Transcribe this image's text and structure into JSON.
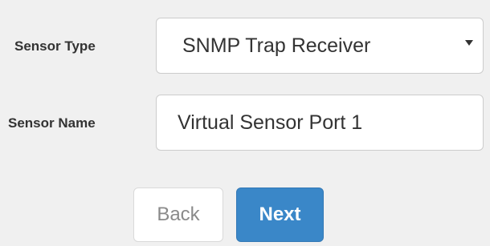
{
  "form": {
    "sensor_type": {
      "label": "Sensor Type",
      "selected_value": "SNMP Trap Receiver",
      "icon": "caret-down-icon"
    },
    "sensor_name": {
      "label": "Sensor Name",
      "value": "Virtual Sensor Port 1"
    }
  },
  "buttons": {
    "back_label": "Back",
    "next_label": "Next"
  },
  "colors": {
    "panel_background": "#f0f0f0",
    "primary_button": "#3a87c8",
    "label_text": "#333333",
    "disabled_text": "#8a8a8a"
  }
}
